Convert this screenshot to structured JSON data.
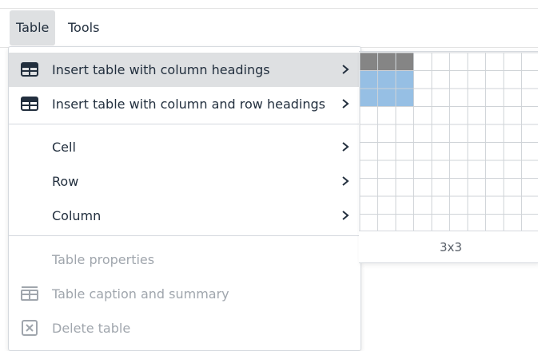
{
  "menubar": {
    "items": [
      {
        "label": "Table",
        "active": true
      },
      {
        "label": "Tools",
        "active": false
      }
    ]
  },
  "menu": {
    "items": [
      {
        "label": "Insert table with column headings",
        "icon": "table-icon",
        "submenu": true,
        "hover": true,
        "disabled": false
      },
      {
        "label": "Insert table with column and row headings",
        "icon": "table-icon",
        "submenu": true,
        "hover": false,
        "disabled": false
      },
      {
        "label": "Cell",
        "icon": "",
        "submenu": true,
        "hover": false,
        "disabled": false
      },
      {
        "label": "Row",
        "icon": "",
        "submenu": true,
        "hover": false,
        "disabled": false
      },
      {
        "label": "Column",
        "icon": "",
        "submenu": true,
        "hover": false,
        "disabled": false
      },
      {
        "label": "Table properties",
        "icon": "",
        "submenu": false,
        "hover": false,
        "disabled": true
      },
      {
        "label": "Table caption and summary",
        "icon": "table-caption-icon",
        "submenu": false,
        "hover": false,
        "disabled": true
      },
      {
        "label": "Delete table",
        "icon": "delete-table-icon",
        "submenu": false,
        "hover": false,
        "disabled": true
      }
    ]
  },
  "grid_picker": {
    "readout": "3x3",
    "selected_cols": 3,
    "selected_rows": 3,
    "header_rows": 1
  },
  "colors": {
    "header_cell": "#858585",
    "selected_cell": "#96bfe4",
    "grid_line": "#cfd3d7",
    "hover_bg": "#dee0e2"
  }
}
